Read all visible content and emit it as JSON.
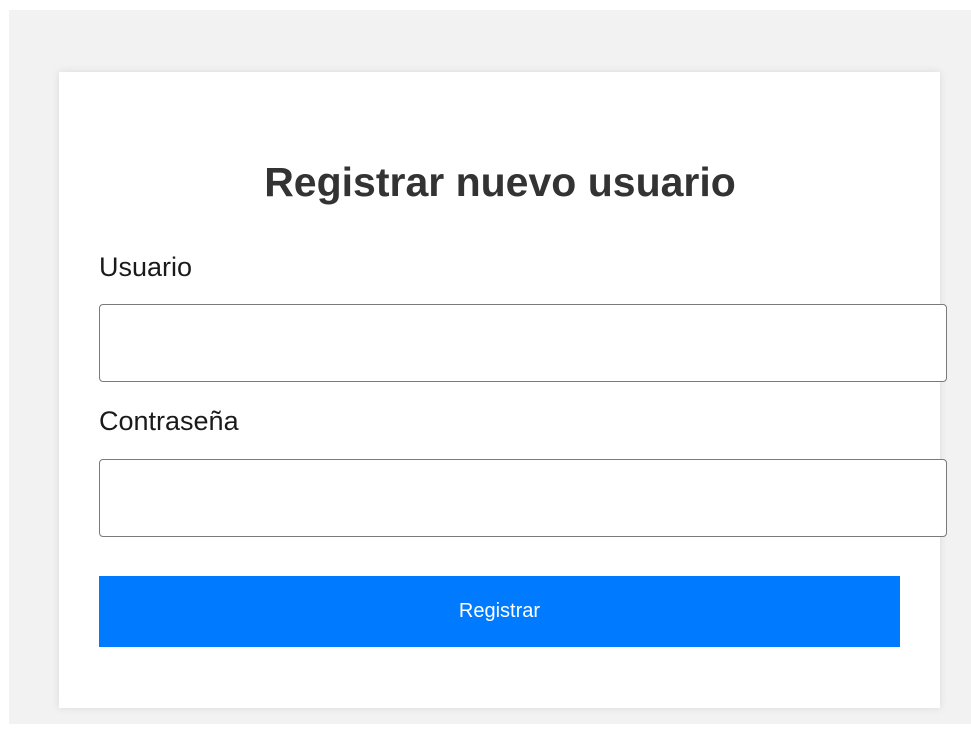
{
  "form": {
    "title": "Registrar nuevo usuario",
    "username_label": "Usuario",
    "username_value": "",
    "username_placeholder": "",
    "password_label": "Contraseña",
    "password_value": "",
    "password_placeholder": "",
    "submit_label": "Registrar"
  },
  "colors": {
    "page_background": "#f2f2f2",
    "card_background": "#ffffff",
    "title_text": "#333333",
    "button_background": "#007bff",
    "button_text": "#ffffff",
    "input_border": "#7a7a7a"
  }
}
